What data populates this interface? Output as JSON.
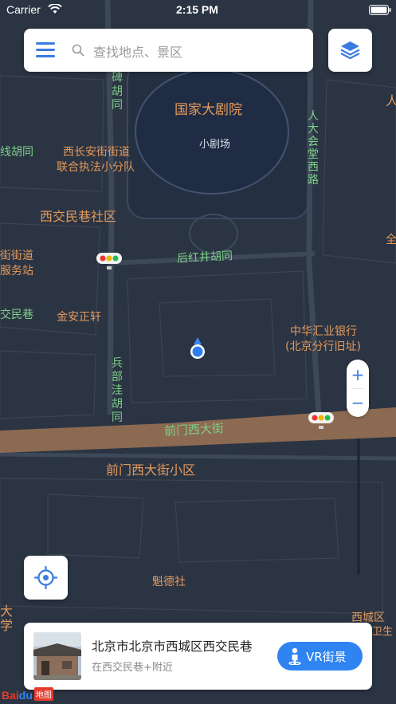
{
  "status_bar": {
    "carrier": "Carrier",
    "time": "2:15 PM"
  },
  "search": {
    "placeholder": "查找地点、景区"
  },
  "icons": {
    "menu": "menu-icon",
    "search": "search-icon",
    "layers": "layers-icon",
    "locate": "locate-icon",
    "vr": "person-icon",
    "location": "location-marker-icon",
    "traffic": "traffic-light-icon"
  },
  "zoom": {
    "in": "+",
    "out": "−"
  },
  "map": {
    "labels": [
      {
        "text": "国家大剧院",
        "color": "#e59a5c"
      },
      {
        "text": "小剧场",
        "color": "#d8dee6"
      },
      {
        "text": "人大会堂西路",
        "color": "#7fd08a"
      },
      {
        "text": "西长安街街道",
        "color": "#e59a5c"
      },
      {
        "text": "联合执法小分队",
        "color": "#e59a5c"
      },
      {
        "text": "西交民巷社区",
        "color": "#e59a5c"
      },
      {
        "text": "后红井胡同",
        "color": "#7fd08a"
      },
      {
        "text": "线胡同",
        "color": "#7fd08a"
      },
      {
        "text": "街街道",
        "color": "#e59a5c"
      },
      {
        "text": "服务站",
        "color": "#e59a5c"
      },
      {
        "text": "交民巷",
        "color": "#7fd08a"
      },
      {
        "text": "金安正轩",
        "color": "#e59a5c"
      },
      {
        "text": "中华汇业银行",
        "color": "#e59a5c"
      },
      {
        "text": "(北京分行旧址)",
        "color": "#e59a5c"
      },
      {
        "text": "兵部洼胡同",
        "color": "#7fd08a"
      },
      {
        "text": "前门西大街",
        "color": "#7fd08a"
      },
      {
        "text": "前门西大街小区",
        "color": "#e59a5c"
      },
      {
        "text": "魁德社",
        "color": "#e59a5c"
      },
      {
        "text": "大学",
        "color": "#e59a5c"
      },
      {
        "text": "西城区",
        "color": "#e59a5c"
      },
      {
        "text": "卫生",
        "color": "#e59a5c"
      },
      {
        "text": "碑胡同",
        "color": "#7fd08a"
      },
      {
        "text": "人",
        "color": "#e59a5c"
      },
      {
        "text": "全",
        "color": "#e59a5c"
      }
    ]
  },
  "place_card": {
    "title": "北京市北京市西城区西交民巷",
    "subtitle": "在西交民巷+附近",
    "vr_button": "VR街景"
  },
  "logo": {
    "bai": "Bai",
    "du": "du",
    "map": "地图"
  }
}
